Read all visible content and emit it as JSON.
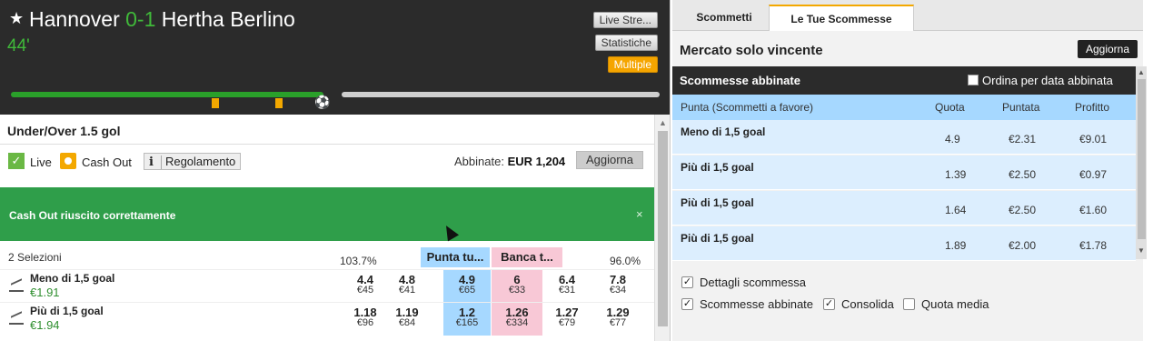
{
  "match": {
    "home": "Hannover",
    "score": "0-1",
    "away": "Hertha Berlino",
    "minute": "44'",
    "buttons": {
      "live_stream": "Live Stre...",
      "stats": "Statistiche",
      "multiple": "Multiple"
    }
  },
  "market": {
    "title": "Under/Over 1.5 gol",
    "live_label": "Live",
    "cashout_label": "Cash Out",
    "rules_label": "Regolamento",
    "matched_label": "Abbinate:",
    "matched_value": "EUR 1,204",
    "refresh_label": "Aggiorna",
    "cashout_message": "Cash Out riuscito correttamente",
    "close_glyph": "×",
    "selections_count": "2 Selezioni",
    "back_pct": "103.7%",
    "lay_pct": "96.0%",
    "back_header": "Punta tu...",
    "lay_header": "Banca t...",
    "runners": [
      {
        "name": "Meno di 1,5 goal",
        "pl": "€1.91",
        "prices": [
          {
            "odd": "4.4",
            "amt": "€45"
          },
          {
            "odd": "4.8",
            "amt": "€41"
          },
          {
            "odd": "4.9",
            "amt": "€65"
          },
          {
            "odd": "6",
            "amt": "€33"
          },
          {
            "odd": "6.4",
            "amt": "€31"
          },
          {
            "odd": "7.8",
            "amt": "€34"
          }
        ]
      },
      {
        "name": "Più di 1,5 goal",
        "pl": "€1.94",
        "prices": [
          {
            "odd": "1.18",
            "amt": "€96"
          },
          {
            "odd": "1.19",
            "amt": "€84"
          },
          {
            "odd": "1.2",
            "amt": "€165"
          },
          {
            "odd": "1.26",
            "amt": "€334"
          },
          {
            "odd": "1.27",
            "amt": "€79"
          },
          {
            "odd": "1.29",
            "amt": "€77"
          }
        ]
      }
    ]
  },
  "betslip": {
    "tabs": [
      "Scommetti",
      "Le Tue Scommesse"
    ],
    "market_title": "Mercato solo vincente",
    "refresh_label": "Aggiorna",
    "matched_title": "Scommesse abbinate",
    "sort_label": "Ordina per data abbinata",
    "columns": {
      "selection": "Punta (Scommetti a favore)",
      "odds": "Quota",
      "stake": "Puntata",
      "profit": "Profitto"
    },
    "bets": [
      {
        "name": "Meno di 1,5 goal",
        "odds": "4.9",
        "stake": "€2.31",
        "profit": "€9.01"
      },
      {
        "name": "Più di 1,5 goal",
        "odds": "1.39",
        "stake": "€2.50",
        "profit": "€0.97"
      },
      {
        "name": "Più di 1,5 goal",
        "odds": "1.64",
        "stake": "€2.50",
        "profit": "€1.60"
      },
      {
        "name": "Più di 1,5 goal",
        "odds": "1.89",
        "stake": "€2.00",
        "profit": "€1.78"
      }
    ],
    "options": {
      "details": "Dettagli scommessa",
      "matched": "Scommesse abbinate",
      "consolidate": "Consolida",
      "avg_odds": "Quota media"
    }
  },
  "colors": {
    "live_green": "#40b93a",
    "back_blue": "#a6d8ff",
    "lay_pink": "#f8c8d6",
    "banner_green": "#2f9e4a",
    "accent_orange": "#f3a800"
  }
}
